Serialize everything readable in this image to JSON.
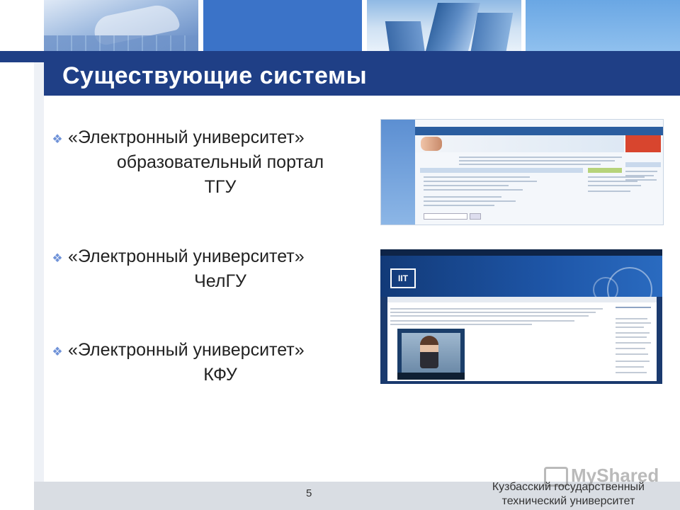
{
  "slide": {
    "title": "Существующие системы",
    "page_number": "5",
    "organization_line1": "Кузбасский государственный",
    "organization_line2": "технический университет"
  },
  "bullets": [
    {
      "line1": "«Электронный университет»",
      "line2": "образовательный портал",
      "line3": "ТГУ"
    },
    {
      "line1": "«Электронный университет»",
      "line2": "ЧелГУ"
    },
    {
      "line1": "«Электронный университет»",
      "line2": "КФУ"
    }
  ],
  "watermark": "MyShared",
  "colors": {
    "title_bar": "#1f3f86",
    "bullet_symbol": "#6f92d8",
    "footer": "#d9dde3"
  },
  "icons": {
    "bullet": "diamond-bullet-icon"
  }
}
